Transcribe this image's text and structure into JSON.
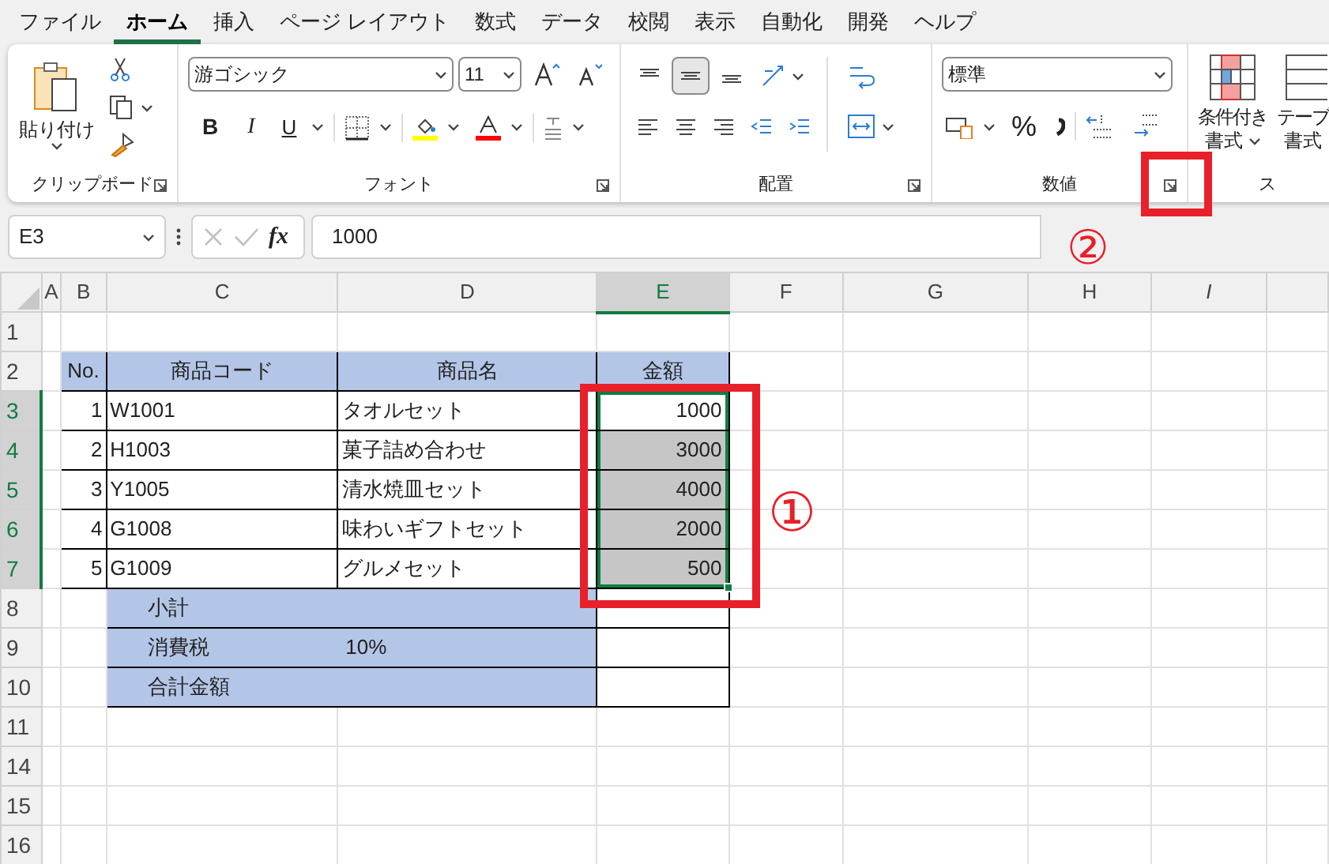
{
  "menu_tabs": [
    {
      "label": "ファイル",
      "selected": false
    },
    {
      "label": "ホーム",
      "selected": true
    },
    {
      "label": "挿入",
      "selected": false
    },
    {
      "label": "ページ レイアウト",
      "selected": false
    },
    {
      "label": "数式",
      "selected": false
    },
    {
      "label": "データ",
      "selected": false
    },
    {
      "label": "校閲",
      "selected": false
    },
    {
      "label": "表示",
      "selected": false
    },
    {
      "label": "自動化",
      "selected": false
    },
    {
      "label": "開発",
      "selected": false
    },
    {
      "label": "ヘルプ",
      "selected": false
    }
  ],
  "ribbon": {
    "clipboard": {
      "paste_label": "貼り付け",
      "group_label": "クリップボード"
    },
    "font": {
      "font_name": "游ゴシック",
      "font_size": "11",
      "bold": "B",
      "italic": "I",
      "underline": "U",
      "group_label": "フォント"
    },
    "alignment": {
      "vertical_align": [
        {
          "selected": false
        },
        {
          "selected": true
        },
        {
          "selected": false
        }
      ],
      "group_label": "配置"
    },
    "number": {
      "format": "標準",
      "percent": "%",
      "group_label": "数値"
    },
    "styles": {
      "buttons": [
        {
          "line1": "条件付き",
          "line2": "書式"
        },
        {
          "line1": "テーブ",
          "line2": "書式"
        }
      ],
      "group_label": "ス"
    }
  },
  "formula_bar": {
    "name_box": "E3",
    "function_label": "fx",
    "formula": "1000"
  },
  "sheet": {
    "columns": [
      {
        "label": "A",
        "selected": false
      },
      {
        "label": "B",
        "selected": false
      },
      {
        "label": "C",
        "selected": false
      },
      {
        "label": "D",
        "selected": false
      },
      {
        "label": "E",
        "selected": true
      },
      {
        "label": "F",
        "selected": false
      },
      {
        "label": "G",
        "selected": false
      },
      {
        "label": "H",
        "selected": false
      },
      {
        "label": "I",
        "selected": false
      }
    ],
    "rows": [
      {
        "kind": "blank",
        "row": "1",
        "selected": false
      },
      {
        "kind": "header",
        "row": "2",
        "selected": false,
        "no": "No.",
        "code": "商品コード",
        "name": "商品名",
        "amount_header": "金額"
      },
      {
        "kind": "item",
        "row": "3",
        "selected": true,
        "no": "1",
        "code": "W1001",
        "name": "タオルセット",
        "amount": {
          "text": "1000",
          "selected": true,
          "active": true
        }
      },
      {
        "kind": "item",
        "row": "4",
        "selected": true,
        "no": "2",
        "code": "H1003",
        "name": "菓子詰め合わせ",
        "amount": {
          "text": "3000",
          "selected": true,
          "active": false
        }
      },
      {
        "kind": "item",
        "row": "5",
        "selected": true,
        "no": "3",
        "code": "Y1005",
        "name": "清水焼皿セット",
        "amount": {
          "text": "4000",
          "selected": true,
          "active": false
        }
      },
      {
        "kind": "item",
        "row": "6",
        "selected": true,
        "no": "4",
        "code": "G1008",
        "name": "味わいギフトセット",
        "amount": {
          "text": "2000",
          "selected": true,
          "active": false
        }
      },
      {
        "kind": "item",
        "row": "7",
        "selected": true,
        "no": "5",
        "code": "G1009",
        "name": "グルメセット",
        "amount": {
          "text": "500",
          "selected": true,
          "active": false
        }
      },
      {
        "kind": "summary",
        "row": "8",
        "selected": false,
        "label": "小計"
      },
      {
        "kind": "summary",
        "row": "9",
        "selected": false,
        "label": "消費税",
        "value": "10%"
      },
      {
        "kind": "summary",
        "row": "10",
        "selected": false,
        "label": "合計金額"
      },
      {
        "kind": "blank",
        "row": "11",
        "selected": false
      },
      {
        "kind": "blank",
        "row": "14",
        "selected": false
      },
      {
        "kind": "blank",
        "row": "15",
        "selected": false
      },
      {
        "kind": "blank",
        "row": "16",
        "selected": false
      }
    ]
  },
  "markers": [
    {
      "label": "①"
    },
    {
      "label": "②"
    }
  ]
}
